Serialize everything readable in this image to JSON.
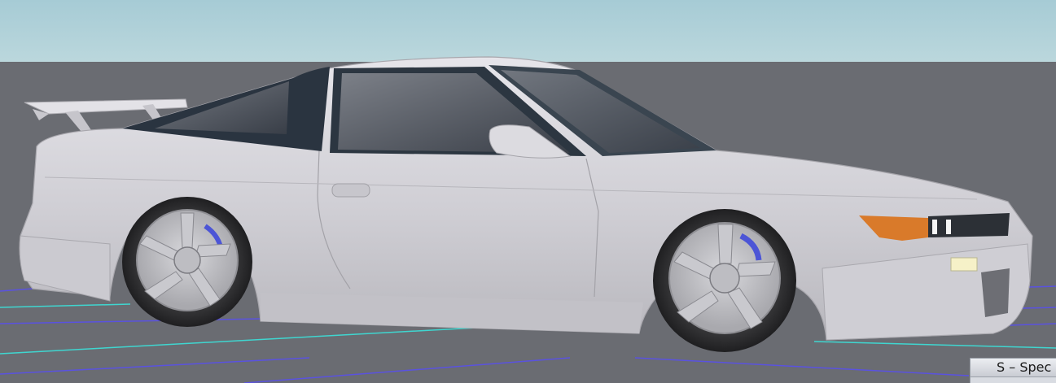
{
  "hud": {
    "class_badge": "S – Spec"
  },
  "colors": {
    "sky": "#a9cdd6",
    "floor": "#6a6c72",
    "grid_blue": "#5a52e0",
    "grid_cyan": "#3fd6d0",
    "car_body": "#d4d3d8",
    "glass": "#2a3440"
  }
}
